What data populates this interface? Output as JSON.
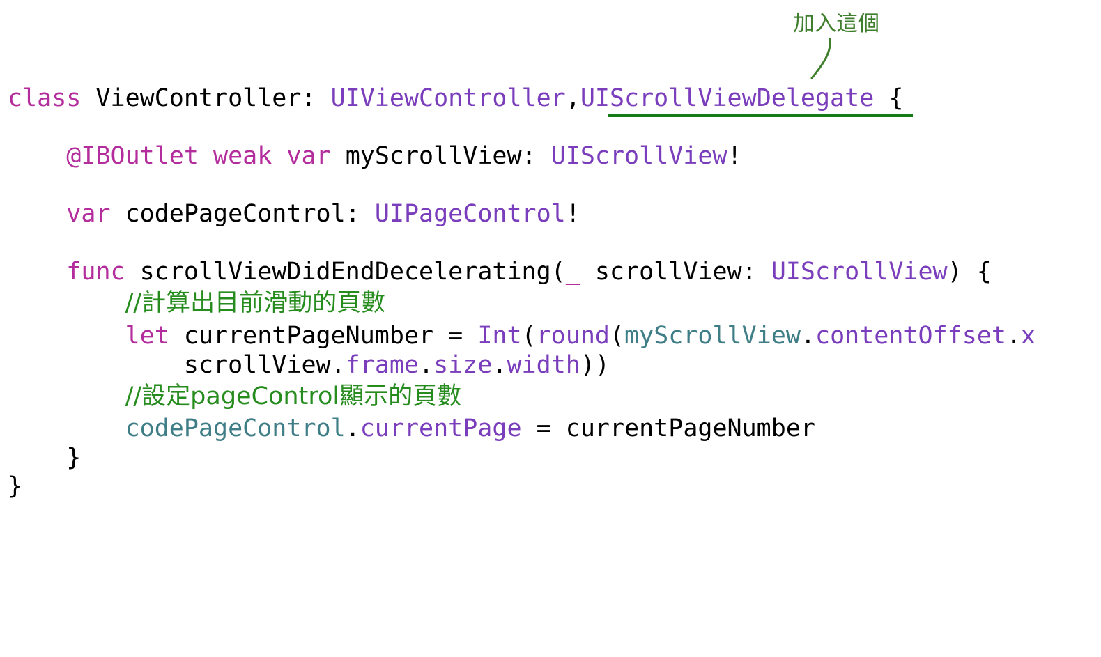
{
  "annotation": {
    "label": "加入這個",
    "color": "#3f7e2c"
  },
  "colors": {
    "keyword": "#b42d9c",
    "type": "#7a3dbb",
    "variable": "#3f7e86",
    "comment": "#268c1e",
    "plain": "#000000",
    "highlight_underline": "#187c16"
  },
  "code": {
    "line1": {
      "kw_class": "class",
      "class_name": " ViewController: ",
      "super_type": "UIViewController",
      "comma": ",",
      "protocol": "UIScrollViewDelegate",
      "brace_open": " {"
    },
    "line2": {
      "indent": "    ",
      "attr": "@IBOutlet",
      "space1": " ",
      "kw_weak": "weak",
      "space2": " ",
      "kw_var": "var",
      "name": " myScrollView: ",
      "type": "UIScrollView",
      "bang": "!"
    },
    "line3": {
      "indent": "    ",
      "kw_var": "var",
      "name": " codePageControl: ",
      "type": "UIPageControl",
      "bang": "!"
    },
    "line4": {
      "indent": "    ",
      "kw_func": "func",
      "name": " scrollViewDidEndDecelerating(",
      "underscore": "_",
      "param": " scrollView: ",
      "type": "UIScrollView",
      "tail": ") {"
    },
    "line5": {
      "indent": "        ",
      "comment": "//計算出目前滑動的頁數"
    },
    "line6": {
      "indent": "        ",
      "kw_let": "let",
      "assign": " currentPageNumber = ",
      "fn_int": "Int",
      "paren1": "(",
      "fn_round": "round",
      "paren2": "(",
      "obj": "myScrollView",
      "dot": ".",
      "prop": "contentOffset",
      "dot2": ".",
      "prop2": "x"
    },
    "line7": {
      "indent": "            ",
      "obj": "scrollView",
      "dot1": ".",
      "prop1": "frame",
      "dot2": ".",
      "prop2": "size",
      "dot3": ".",
      "prop3": "width",
      "close": "))"
    },
    "line8": {
      "indent": "        ",
      "comment": "//設定pageControl顯示的頁數"
    },
    "line9": {
      "indent": "        ",
      "obj": "codePageControl",
      "dot": ".",
      "prop": "currentPage",
      "rest": " = currentPageNumber"
    },
    "line10": {
      "indent": "    ",
      "brace": "}"
    },
    "line11": {
      "brace": "}"
    }
  }
}
